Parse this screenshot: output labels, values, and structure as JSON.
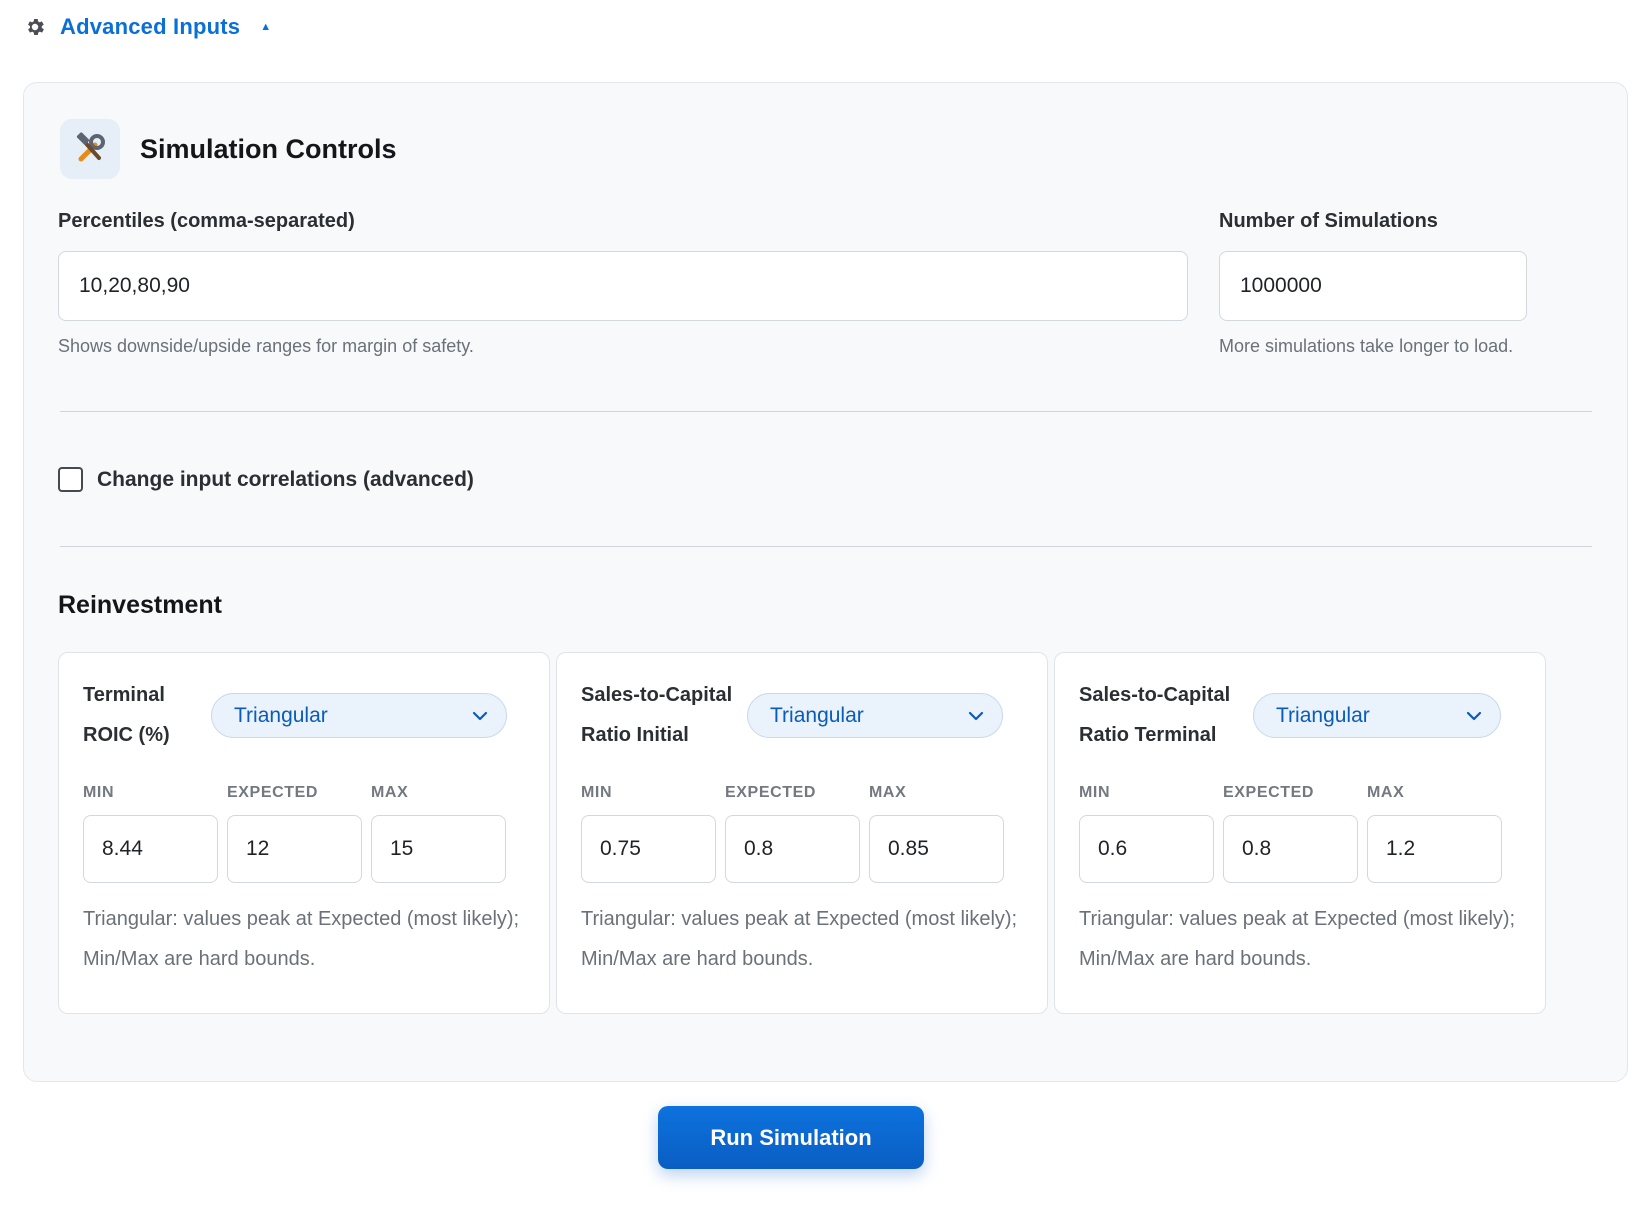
{
  "header": {
    "toggle_label": "Advanced Inputs",
    "toggle_icon": "gear-icon",
    "caret_icon": "caret-up-icon",
    "accent_color": "#0a6fd8"
  },
  "panel": {
    "title": "Simulation Controls",
    "title_icon": "tools-icon",
    "percentiles": {
      "label": "Percentiles (comma-separated)",
      "value": "10,20,80,90",
      "hint": "Shows downside/upside ranges for margin of safety."
    },
    "simulations": {
      "label": "Number of Simulations",
      "value": "1000000",
      "hint": "More simulations take longer to load."
    },
    "correlations": {
      "label": "Change input correlations (advanced)",
      "checked": false
    },
    "section_title": "Reinvestment",
    "column_labels": {
      "min": "MIN",
      "expected": "EXPECTED",
      "max": "MAX"
    },
    "cards": [
      {
        "label_line1": "Terminal",
        "label_line2": "ROIC (%)",
        "distribution": "Triangular",
        "min": "8.44",
        "expected": "12",
        "max": "15",
        "note": "Triangular: values peak at Expected (most likely); Min/Max are hard bounds."
      },
      {
        "label_line1": "Sales-to-Capital",
        "label_line2": "Ratio Initial",
        "distribution": "Triangular",
        "min": "0.75",
        "expected": "0.8",
        "max": "0.85",
        "note": "Triangular: values peak at Expected (most likely); Min/Max are hard bounds."
      },
      {
        "label_line1": "Sales-to-Capital",
        "label_line2": "Ratio Terminal",
        "distribution": "Triangular",
        "min": "0.6",
        "expected": "0.8",
        "max": "1.2",
        "note": "Triangular: values peak at Expected (most likely); Min/Max are hard bounds."
      }
    ]
  },
  "actions": {
    "run_label": "Run Simulation",
    "button_color": "#0a66cc"
  }
}
